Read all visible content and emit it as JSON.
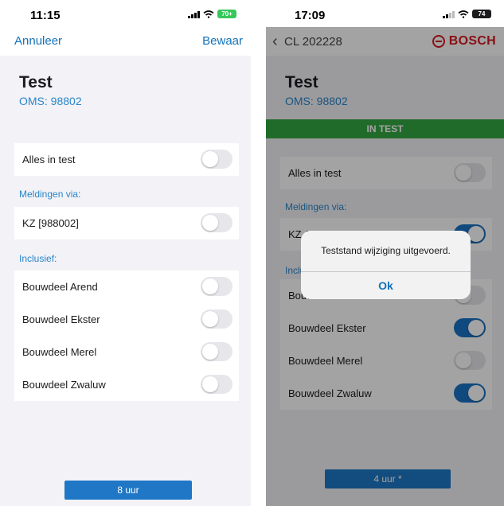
{
  "left_screen": {
    "status_bar": {
      "time": "11:15",
      "battery": "70+"
    },
    "nav": {
      "cancel_label": "Annuleer",
      "save_label": "Bewaar"
    },
    "header": {
      "title": "Test",
      "subtitle": "OMS: 98802"
    },
    "all_in_test": {
      "label": "Alles in test",
      "on": false
    },
    "notifications": {
      "heading": "Meldingen via:",
      "items": [
        {
          "label": "KZ [988002]",
          "on": false
        }
      ]
    },
    "inclusive": {
      "heading": "Inclusief:",
      "items": [
        {
          "label": "Bouwdeel Arend",
          "on": false
        },
        {
          "label": "Bouwdeel Ekster",
          "on": false
        },
        {
          "label": "Bouwdeel Merel",
          "on": false
        },
        {
          "label": "Bouwdeel Zwaluw",
          "on": false
        }
      ]
    },
    "duration_button": "8 uur"
  },
  "right_screen": {
    "status_bar": {
      "time": "17:09",
      "battery": "74"
    },
    "nav": {
      "back_title": "CL 202228",
      "brand": "BOSCH"
    },
    "header": {
      "title": "Test",
      "subtitle": "OMS: 98802"
    },
    "status_banner": "IN TEST",
    "status_banner_color": "#35a843",
    "all_in_test": {
      "label": "Alles in test",
      "on": false
    },
    "notifications": {
      "heading": "Meldingen via:",
      "items": [
        {
          "label": "KZ A",
          "on": true
        }
      ]
    },
    "inclusive": {
      "heading": "Inclu",
      "items": [
        {
          "label": "Bouw",
          "on": false
        },
        {
          "label": "Bouwdeel Ekster",
          "on": true
        },
        {
          "label": "Bouwdeel Merel",
          "on": false
        },
        {
          "label": "Bouwdeel Zwaluw",
          "on": true
        }
      ]
    },
    "duration_button": "4 uur *",
    "alert": {
      "message": "Teststand wijziging uitgevoerd.",
      "ok_label": "Ok"
    }
  },
  "colors": {
    "accent": "#1273b9",
    "toggle_on": "#1a73c5",
    "brand": "#d61920"
  }
}
